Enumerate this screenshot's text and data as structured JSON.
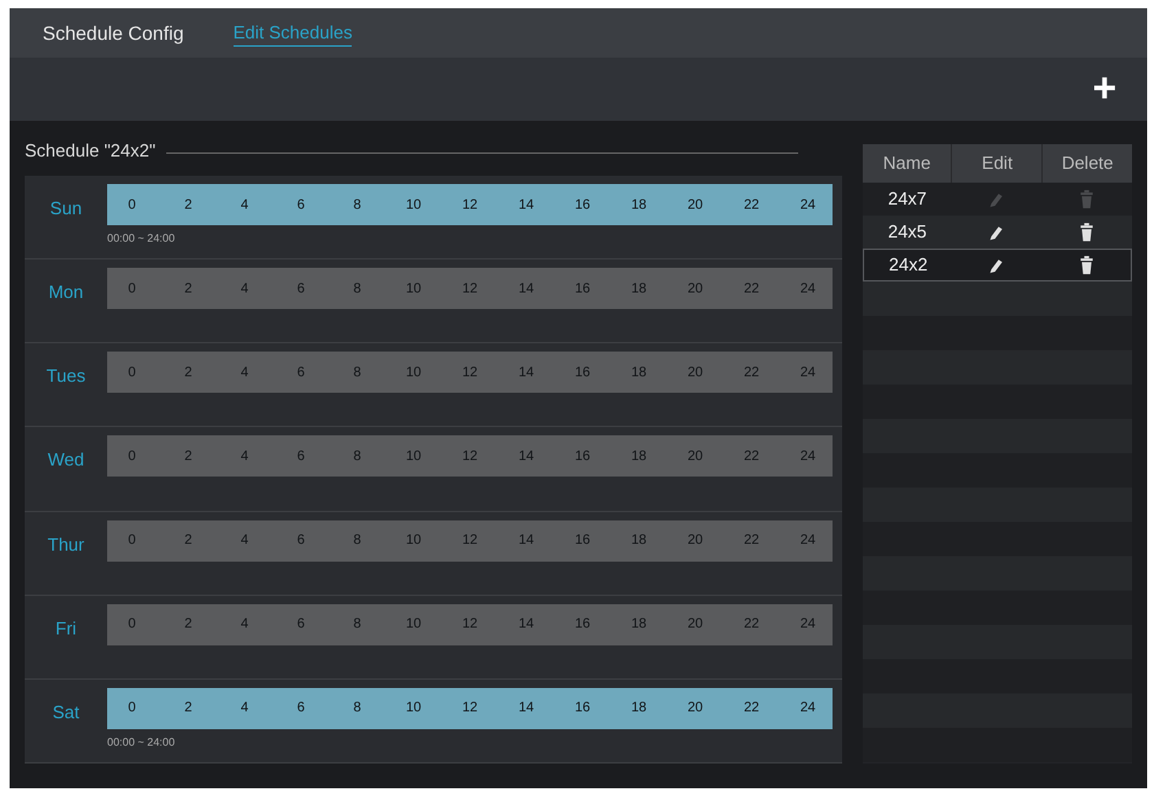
{
  "tabs": [
    {
      "label": "Schedule Config",
      "selected": false
    },
    {
      "label": "Edit Schedules",
      "selected": true
    }
  ],
  "toolbar": {
    "add_button": "+"
  },
  "schedule": {
    "title": "Schedule \"24x2\"",
    "days": [
      {
        "label": "Sun",
        "level": 1,
        "range": "00:00 ~ 24:00",
        "hours": [
          "0",
          "2",
          "4",
          "6",
          "8",
          "10",
          "12",
          "14",
          "16",
          "18",
          "20",
          "22",
          "24"
        ]
      },
      {
        "label": "Mon",
        "level": 0,
        "hours": [
          "0",
          "2",
          "4",
          "6",
          "8",
          "10",
          "12",
          "14",
          "16",
          "18",
          "20",
          "22",
          "24"
        ]
      },
      {
        "label": "Tues",
        "level": 0,
        "hours": [
          "0",
          "2",
          "4",
          "6",
          "8",
          "10",
          "12",
          "14",
          "16",
          "18",
          "20",
          "22",
          "24"
        ]
      },
      {
        "label": "Wed",
        "level": 0,
        "hours": [
          "0",
          "2",
          "4",
          "6",
          "8",
          "10",
          "12",
          "14",
          "16",
          "18",
          "20",
          "22",
          "24"
        ]
      },
      {
        "label": "Thur",
        "level": 0,
        "hours": [
          "0",
          "2",
          "4",
          "6",
          "8",
          "10",
          "12",
          "14",
          "16",
          "18",
          "20",
          "22",
          "24"
        ]
      },
      {
        "label": "Fri",
        "level": 0,
        "hours": [
          "0",
          "2",
          "4",
          "6",
          "8",
          "10",
          "12",
          "14",
          "16",
          "18",
          "20",
          "22",
          "24"
        ]
      },
      {
        "label": "Sat",
        "level": 1,
        "range": "00:00 ~ 24:00",
        "hours": [
          "0",
          "2",
          "4",
          "6",
          "8",
          "10",
          "12",
          "14",
          "16",
          "18",
          "20",
          "22",
          "24"
        ]
      }
    ]
  },
  "table": {
    "columns": [
      "Name",
      "Edit",
      "Delete"
    ],
    "rows": [
      {
        "name": "24x7",
        "disabled": true,
        "selected": false
      },
      {
        "name": "24x5",
        "disabled": false,
        "selected": false
      },
      {
        "name": "24x2",
        "disabled": false,
        "selected": true
      }
    ]
  }
}
